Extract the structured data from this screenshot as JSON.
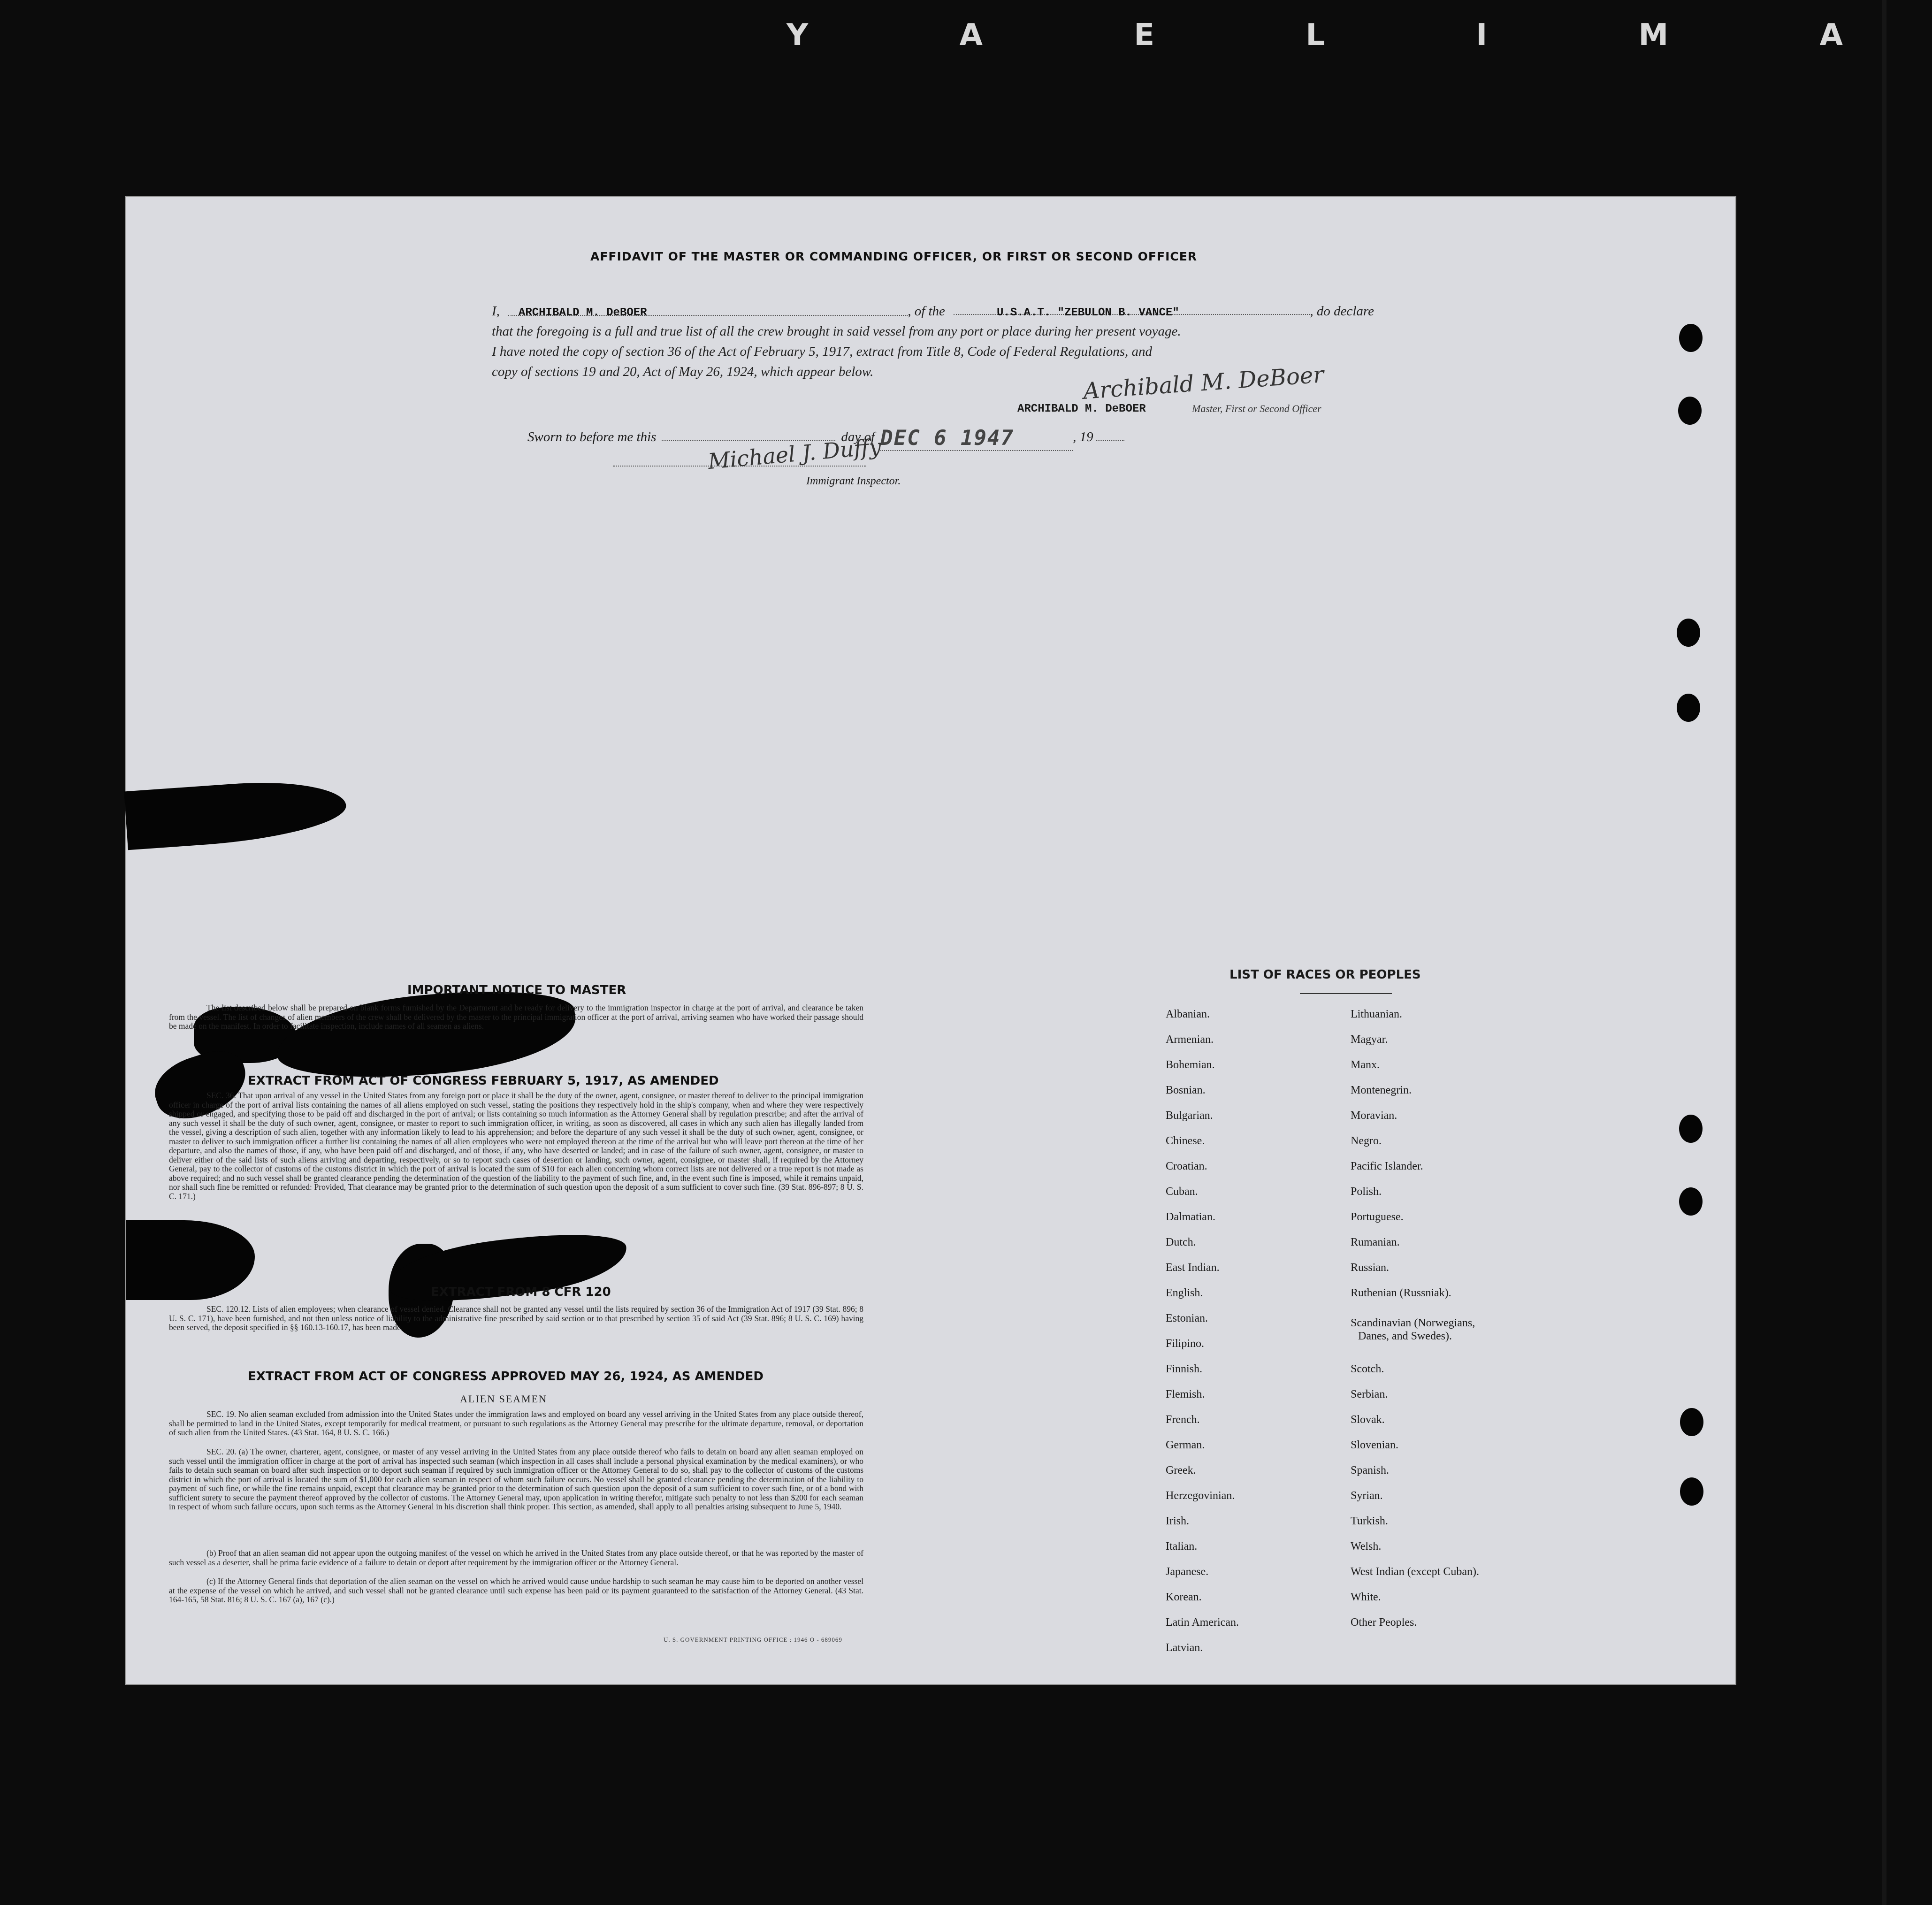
{
  "film_edge": {
    "letters": "Y A E L I M A"
  },
  "affidavit": {
    "title": "AFFIDAVIT OF THE MASTER OR COMMANDING OFFICER, OR FIRST OR SECOND OFFICER",
    "intro": "I,",
    "master_name": "ARCHIBALD M. DeBOER",
    "of_the": ", of the",
    "vessel": "U.S.A.T. \"ZEBULON B. VANCE\"",
    "do_declare": ", do declare",
    "line2": "that the foregoing is a full and true list of all the crew brought in said vessel from any port or place during her present voyage.",
    "line3": "I have noted the copy of section 36 of the Act of February 5, 1917, extract from Title 8, Code of Federal Regulations, and",
    "line4": "copy of sections 19 and 20, Act of May 26, 1924, which appear below.",
    "signature_script": "Archibald M. DeBoer",
    "signature_typed": "ARCHIBALD M. DeBOER",
    "signature_role": "Master, First or Second Officer",
    "sworn_label": "Sworn to before me this",
    "day_of": "day of",
    "stamp_date": "DEC 6  1947",
    "year_prefix": ", 19",
    "inspector_signature": "Michael J. Duffy",
    "inspector_label": "Immigrant Inspector."
  },
  "notice": {
    "title": "IMPORTANT NOTICE TO MASTER",
    "text": "The list described below shall be prepared on blank forms furnished by the Department and be ready for delivery to the immigration inspector in charge at the port of arrival, and clearance be taken from the vessel. The list of changes of alien members of the crew shall be delivered by the master to the principal immigration officer at the port of arrival, arriving seamen who have worked their passage should be made on the manifest. In order to facilitate inspection, include names of all seamen as aliens."
  },
  "act1917": {
    "title": "EXTRACT FROM ACT OF CONGRESS FEBRUARY 5, 1917, AS AMENDED",
    "text": "SEC. 36. That upon arrival of any vessel in the United States from any foreign port or place it shall be the duty of the owner, agent, consignee, or master thereof to deliver to the principal immigration officer in charge of the port of arrival lists containing the names of all aliens employed on such vessel, stating the positions they respectively hold in the ship's company, when and where they were respectively shipped or engaged, and specifying those to be paid off and discharged in the port of arrival; or lists containing so much information as the Attorney General shall by regulation prescribe; and after the arrival of any such vessel it shall be the duty of such owner, agent, consignee, or master to report to such immigration officer, in writing, as soon as discovered, all cases in which any such alien has illegally landed from the vessel, giving a description of such alien, together with any information likely to lead to his apprehension; and before the departure of any such vessel it shall be the duty of such owner, agent, consignee, or master to deliver to such immigration officer a further list containing the names of all alien employees who were not employed thereon at the time of the arrival but who will leave port thereon at the time of her departure, and also the names of those, if any, who have been paid off and discharged, and of those, if any, who have deserted or landed; and in case of the failure of such owner, agent, consignee, or master to deliver either of the said lists of such aliens arriving and departing, respectively, or so to report such cases of desertion or landing, such owner, agent, consignee, or master shall, if required by the Attorney General, pay to the collector of customs of the customs district in which the port of arrival is located the sum of $10 for each alien concerning whom correct lists are not delivered or a true report is not made as above required; and no such vessel shall be granted clearance pending the determination of the question of the liability to the payment of such fine, and, in the event such fine is imposed, while it remains unpaid, nor shall such fine be remitted or refunded: Provided, That clearance may be granted prior to the determination of such question upon the deposit of a sum sufficient to cover such fine. (39 Stat. 896-897; 8 U. S. C. 171.)"
  },
  "cfr": {
    "title": "EXTRACT FROM 8 CFR 120",
    "text": "SEC. 120.12. Lists of alien employees; when clearance of vessel denied. Clearance shall not be granted any vessel until the lists required by section 36 of the Immigration Act of 1917 (39 Stat. 896; 8 U. S. C. 171), have been furnished, and not then unless notice of liability to the administrative fine prescribed by said section or to that prescribed by section 35 of said Act (39 Stat. 896; 8 U. S. C. 169) having been served, the deposit specified in §§ 160.13-160.17, has been made."
  },
  "act1924": {
    "title": "EXTRACT FROM ACT OF CONGRESS APPROVED MAY 26, 1924, AS AMENDED",
    "subtitle": "ALIEN SEAMEN",
    "sec19": "SEC. 19. No alien seaman excluded from admission into the United States under the immigration laws and employed on board any vessel arriving in the United States from any place outside thereof, shall be permitted to land in the United States, except temporarily for medical treatment, or pursuant to such regulations as the Attorney General may prescribe for the ultimate departure, removal, or deportation of such alien from the United States. (43 Stat. 164, 8 U. S. C. 166.)",
    "sec20a": "SEC. 20. (a) The owner, charterer, agent, consignee, or master of any vessel arriving in the United States from any place outside thereof who fails to detain on board any alien seaman employed on such vessel until the immigration officer in charge at the port of arrival has inspected such seaman (which inspection in all cases shall include a personal physical examination by the medical examiners), or who fails to detain such seaman on board after such inspection or to deport such seaman if required by such immigration officer or the Attorney General to do so, shall pay to the collector of customs of the customs district in which the port of arrival is located the sum of $1,000 for each alien seaman in respect of whom such failure occurs. No vessel shall be granted clearance pending the determination of the liability to payment of such fine, or while the fine remains unpaid, except that clearance may be granted prior to the determination of such question upon the deposit of a sum sufficient to cover such fine, or of a bond with sufficient surety to secure the payment thereof approved by the collector of customs. The Attorney General may, upon application in writing therefor, mitigate such penalty to not less than $200 for each seaman in respect of whom such failure occurs, upon such terms as the Attorney General in his discretion shall think proper. This section, as amended, shall apply to all penalties arising subsequent to June 5, 1940.",
    "sec20b": "(b) Proof that an alien seaman did not appear upon the outgoing manifest of the vessel on which he arrived in the United States from any place outside thereof, or that he was reported by the master of such vessel as a deserter, shall be prima facie evidence of a failure to detain or deport after requirement by the immigration officer or the Attorney General.",
    "sec20c": "(c) If the Attorney General finds that deportation of the alien seaman on the vessel on which he arrived would cause undue hardship to such seaman he may cause him to be deported on another vessel at the expense of the vessel on which he arrived, and such vessel shall not be granted clearance until such expense has been paid or its payment guaranteed to the satisfaction of the Attorney General. (43 Stat. 164-165, 58 Stat. 816; 8 U. S. C. 167 (a), 167 (c).)"
  },
  "printer": "U. S. GOVERNMENT PRINTING OFFICE : 1946 O - 689069",
  "races": {
    "title": "LIST OF RACES OR PEOPLES",
    "col1": [
      "Albanian.",
      "Armenian.",
      "Bohemian.",
      "Bosnian.",
      "Bulgarian.",
      "Chinese.",
      "Croatian.",
      "Cuban.",
      "Dalmatian.",
      "Dutch.",
      "East Indian.",
      "English.",
      "Estonian.",
      "Filipino.",
      "Finnish.",
      "Flemish.",
      "French.",
      "German.",
      "Greek.",
      "Herzegovinian.",
      "Irish.",
      "Italian.",
      "Japanese.",
      "Korean.",
      "Latin American.",
      "Latvian."
    ],
    "col2": [
      "Lithuanian.",
      "Magyar.",
      "Manx.",
      "Montenegrin.",
      "Moravian.",
      "Negro.",
      "Pacific Islander.",
      "Polish.",
      "Portuguese.",
      "Rumanian.",
      "Russian.",
      "Ruthenian (Russniak).",
      "Scandinavian (Norwegians,",
      "Danes, and Swedes).",
      "Scotch.",
      "Serbian.",
      "Slovak.",
      "Slovenian.",
      "Spanish.",
      "Syrian.",
      "Turkish.",
      "Welsh.",
      "West Indian (except Cuban).",
      "White.",
      "Other Peoples."
    ]
  }
}
